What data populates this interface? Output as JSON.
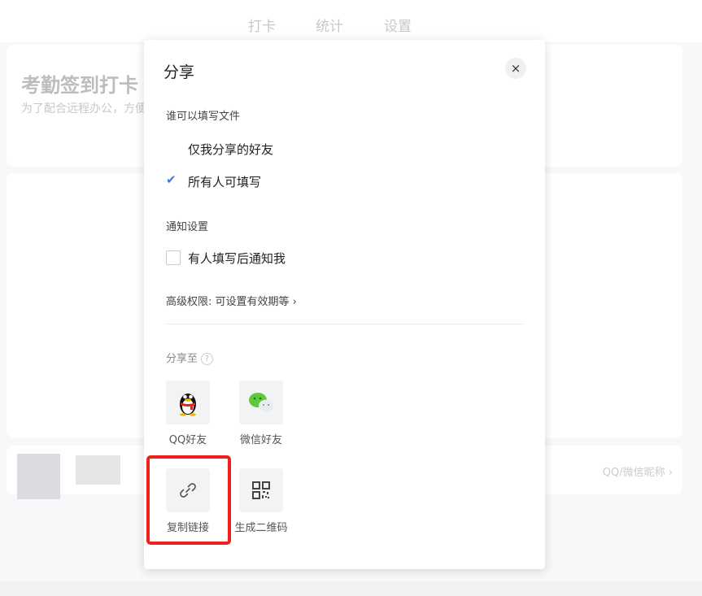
{
  "nav": {
    "tabs": [
      "打卡",
      "统计",
      "设置"
    ]
  },
  "background": {
    "title": "考勤签到打卡",
    "description": "为了配合远程办公，方便大家打卡记录考勤，请大家每天上下班时打开此页面进行打卡记录，谢谢大家",
    "nickname_link": "QQ/微信昵称"
  },
  "modal": {
    "title": "分享",
    "close_icon": "×",
    "who_can_fill_label": "谁可以填写文件",
    "fill_options": [
      {
        "label": "仅我分享的好友",
        "selected": false
      },
      {
        "label": "所有人可填写",
        "selected": true
      }
    ],
    "notify_label": "通知设置",
    "notify_option": {
      "label": "有人填写后通知我",
      "checked": false
    },
    "advanced": "高级权限: 可设置有效期等",
    "share_to_label": "分享至",
    "share_targets": [
      {
        "label": "QQ好友",
        "icon": "qq-icon"
      },
      {
        "label": "微信好友",
        "icon": "wechat-icon"
      },
      {
        "label": "复制链接",
        "icon": "link-icon"
      },
      {
        "label": "生成二维码",
        "icon": "qrcode-icon"
      }
    ]
  },
  "colors": {
    "accent": "#2f7cf6",
    "highlight": "#f0201c"
  }
}
